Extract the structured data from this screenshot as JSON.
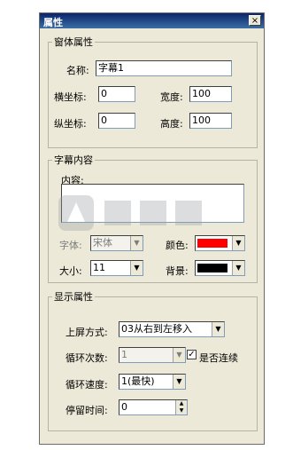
{
  "window": {
    "title": "属性",
    "close_glyph": "×"
  },
  "window_props": {
    "legend": "窗体属性",
    "name_label": "名称:",
    "name_value": "字幕1",
    "x_label": "横坐标:",
    "x_value": "0",
    "y_label": "纵坐标:",
    "y_value": "0",
    "width_label": "宽度:",
    "width_value": "100",
    "height_label": "高度:",
    "height_value": "100"
  },
  "caption_content": {
    "legend": "字幕内容",
    "content_label": "内容:",
    "content_value": "",
    "font_label": "字体:",
    "font_value": "宋体",
    "size_label": "大小:",
    "size_value": "11",
    "color_label": "颜色:",
    "color_hex": "#ff0000",
    "bg_label": "背景:",
    "bg_hex": "#000000"
  },
  "display_props": {
    "legend": "显示属性",
    "screen_mode_label": "上屏方式:",
    "screen_mode_value": "03从右到左移入",
    "loop_count_label": "循环次数:",
    "loop_count_value": "1",
    "continuous_label": "是否连续",
    "continuous_checked": true,
    "check_glyph": "✓",
    "loop_speed_label": "循环速度:",
    "loop_speed_value": "1(最快)",
    "stay_time_label": "停留时间:",
    "stay_time_value": "0"
  },
  "icons": {
    "dropdown": "▼",
    "spin_up": "▲",
    "spin_down": "▼"
  }
}
